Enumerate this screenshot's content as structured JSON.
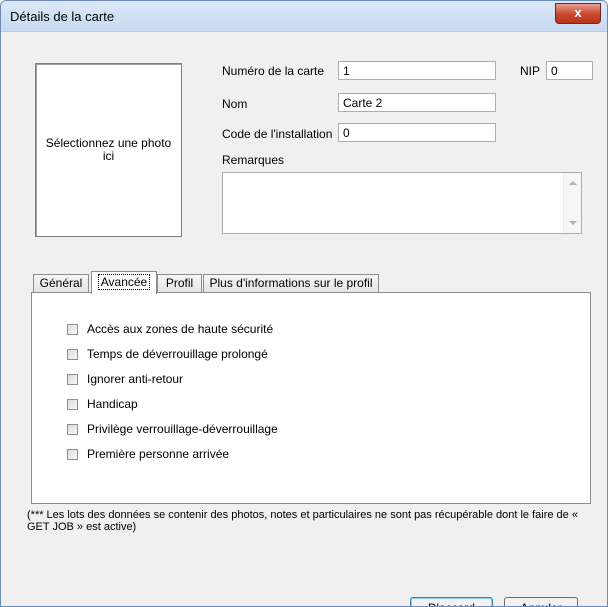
{
  "window": {
    "title": "Détails de la carte",
    "close_glyph": "x"
  },
  "photo": {
    "label": "Sélectionnez une photo ici"
  },
  "form": {
    "card_number_label": "Numéro de la carte",
    "card_number_value": "1",
    "pin_label": "NIP",
    "pin_value": "0",
    "name_label": "Nom",
    "name_value": "Carte 2",
    "facility_code_label": "Code de l'installation",
    "facility_code_value": "0",
    "remarks_label": "Remarques",
    "remarks_value": ""
  },
  "tabs": [
    {
      "label": "Général"
    },
    {
      "label": "Avancée"
    },
    {
      "label": "Profil"
    },
    {
      "label": "Plus d'informations sur le profil"
    }
  ],
  "active_tab": "Avancée",
  "advanced_options": [
    {
      "label": "Accès aux zones de haute sécurité",
      "checked": false
    },
    {
      "label": "Temps de déverrouillage prolongé",
      "checked": false
    },
    {
      "label": "Ignorer anti-retour",
      "checked": false
    },
    {
      "label": "Handicap",
      "checked": false
    },
    {
      "label": "Privilège verrouillage-déverrouillage",
      "checked": false
    },
    {
      "label": "Première personne arrivée",
      "checked": false
    }
  ],
  "note": "(*** Les lots des données se contenir des photos, notes et particulaires ne sont pas récupérable dont le faire de « GET JOB » est active)",
  "buttons": {
    "ok_label": "D'accord",
    "cancel_label": "Annuler"
  },
  "colors": {
    "close_button": "#c9462c",
    "default_button_border": "#3c7fb1"
  }
}
